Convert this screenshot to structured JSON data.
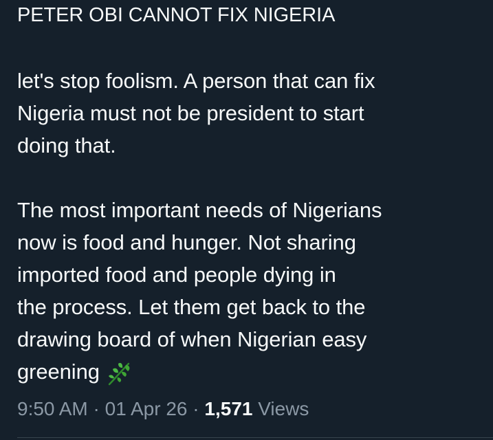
{
  "tweet": {
    "heading": "PETER OBI CANNOT FIX NIGERIA",
    "paragraph1": [
      "let's stop foolism. A person that can fix",
      "Nigeria must not be president to start",
      "doing that."
    ],
    "paragraph2": [
      "The most important needs of Nigerians",
      "now is food and hunger. Not sharing",
      "imported food and people dying in",
      "the process. Let them get back to the",
      "drawing board of when Nigerian easy",
      "greening"
    ],
    "emoji": "herb-icon"
  },
  "meta": {
    "time": "9:50 AM",
    "separator": "·",
    "date": "01 Apr 26",
    "views_count": "1,571",
    "views_label": "Views"
  },
  "colors": {
    "background": "#15202b",
    "text": "#f7f9f9",
    "muted": "#8b98a5",
    "leaf": "#3fa535"
  }
}
